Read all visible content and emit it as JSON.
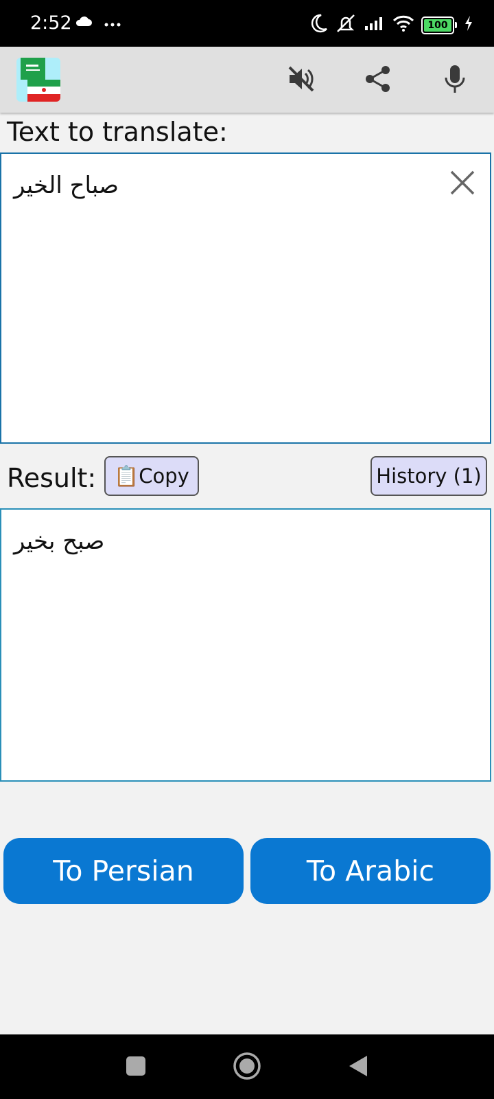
{
  "status_bar": {
    "time": "2:52",
    "battery_level": "100",
    "icons": [
      "cloud-icon",
      "more-dots-icon",
      "moon-icon",
      "vibrate-off-icon",
      "signal-icon",
      "wifi-icon",
      "battery-icon",
      "charging-icon"
    ]
  },
  "toolbar": {
    "icons": [
      "app-logo",
      "mute-icon",
      "share-icon",
      "microphone-icon"
    ]
  },
  "input": {
    "label": "Text to translate:",
    "value": "صباح الخير"
  },
  "result": {
    "label": "Result:",
    "copy_label": "📋Copy",
    "history_label": "History (1)",
    "value": "صبح بخير"
  },
  "actions": {
    "to_persian": "To Persian",
    "to_arabic": "To Arabic"
  },
  "nav": {
    "icons": [
      "recents-square-icon",
      "home-circle-icon",
      "back-triangle-icon"
    ]
  },
  "colors": {
    "accent_blue": "#0a78d2",
    "secondary_button": "#dcdcf8",
    "input_border": "#1a73a8",
    "background": "#f2f2f2"
  }
}
